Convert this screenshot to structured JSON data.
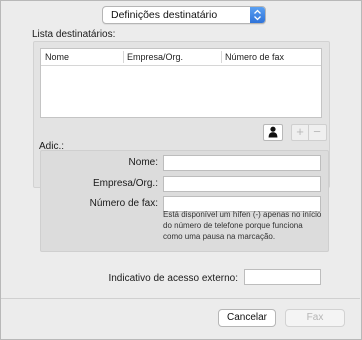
{
  "popup": {
    "selected": "Definições destinatário"
  },
  "recipients": {
    "title": "Lista destinatários:",
    "columns": [
      "Nome",
      "Empresa/Org.",
      "Número de fax"
    ],
    "plus": "+",
    "minus": "−"
  },
  "add": {
    "title": "Adic.:",
    "name_label": "Nome:",
    "company_label": "Empresa/Org.:",
    "fax_label": "Número de fax:",
    "help": "Está disponível um hífen (-) apenas no início do número de telefone porque funciona como uma pausa na marcação.",
    "name_value": "",
    "company_value": "",
    "fax_value": ""
  },
  "external_access": {
    "label": "Indicativo de acesso externo:",
    "value": ""
  },
  "buttons": {
    "cancel": "Cancelar",
    "fax": "Fax"
  }
}
